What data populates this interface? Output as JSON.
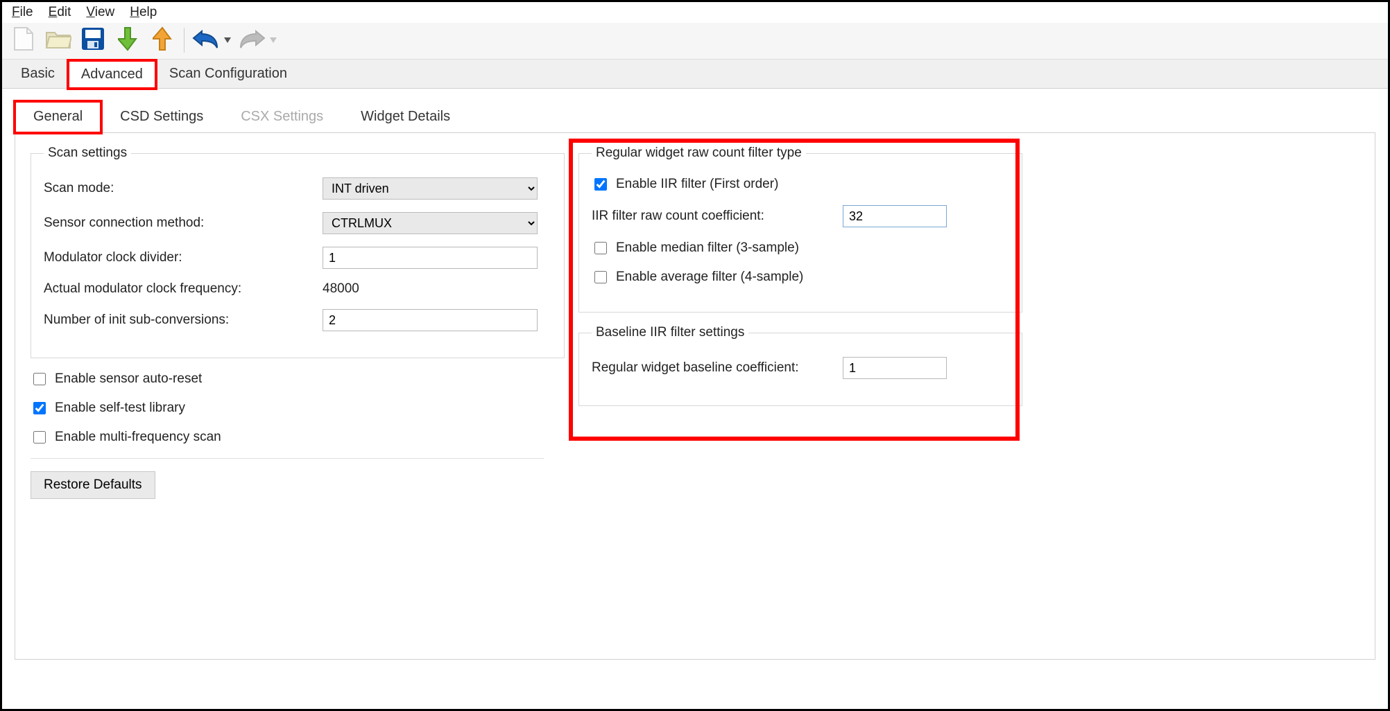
{
  "menubar": {
    "file": "File",
    "edit": "Edit",
    "view": "View",
    "help": "Help"
  },
  "toolbar": {
    "new": "new-icon",
    "open": "open-icon",
    "save": "save-icon",
    "import": "import-icon",
    "export": "export-icon",
    "undo": "undo-icon",
    "redo": "redo-icon"
  },
  "main_tabs": {
    "basic": "Basic",
    "advanced": "Advanced",
    "scan_config": "Scan Configuration"
  },
  "sub_tabs": {
    "general": "General",
    "csd": "CSD Settings",
    "csx": "CSX Settings",
    "widget_details": "Widget Details"
  },
  "scan_settings": {
    "legend": "Scan settings",
    "scan_mode_label": "Scan mode:",
    "scan_mode_value": "INT driven",
    "conn_label": "Sensor connection method:",
    "conn_value": "CTRLMUX",
    "mod_div_label": "Modulator clock divider:",
    "mod_div_value": "1",
    "actual_freq_label": "Actual modulator clock frequency:",
    "actual_freq_value": "48000",
    "init_sub_label": "Number of init sub-conversions:",
    "init_sub_value": "2"
  },
  "checks": {
    "auto_reset": "Enable sensor auto-reset",
    "self_test": "Enable self-test library",
    "multi_freq": "Enable multi-frequency scan"
  },
  "restore_btn": "Restore Defaults",
  "filter_group": {
    "legend": "Regular widget raw count filter type",
    "iir_enable": "Enable IIR filter (First order)",
    "iir_coef_label": "IIR filter raw count coefficient:",
    "iir_coef_value": "32",
    "median": "Enable median filter (3-sample)",
    "average": "Enable average filter (4-sample)"
  },
  "baseline_group": {
    "legend": "Baseline IIR filter settings",
    "coef_label": "Regular widget baseline coefficient:",
    "coef_value": "1"
  }
}
